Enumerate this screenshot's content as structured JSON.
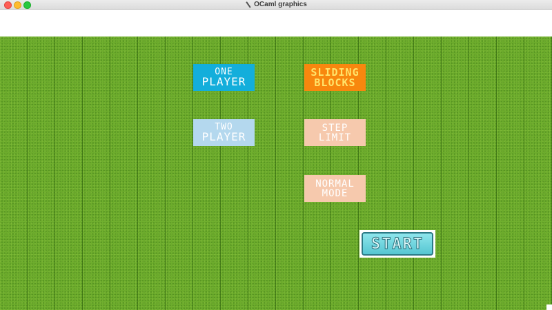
{
  "window": {
    "title": "OCaml graphics",
    "controls": [
      "close",
      "minimize",
      "maximize"
    ]
  },
  "menu": {
    "one_player": {
      "line1": "ONE",
      "line2": "PLAYER"
    },
    "two_player": {
      "line1": "TWO",
      "line2": "PLAYER"
    },
    "sliding_blocks": {
      "line1": "SLIDING",
      "line2": "BLOCKS"
    },
    "step_limit": {
      "line1": "STEP",
      "line2": "LIMIT"
    },
    "normal_mode": {
      "line1": "NORMAL",
      "line2": "MODE"
    },
    "start": "START"
  },
  "colors": {
    "grass": "#6aaa2a",
    "one_player_bg": "#13aedb",
    "two_player_bg": "#b4d8ee",
    "sliding_blocks_bg": "#f8870e",
    "sliding_blocks_text": "#ffe46b",
    "option_bg": "#f6c9ad",
    "start_bg": "#55c6d2"
  }
}
